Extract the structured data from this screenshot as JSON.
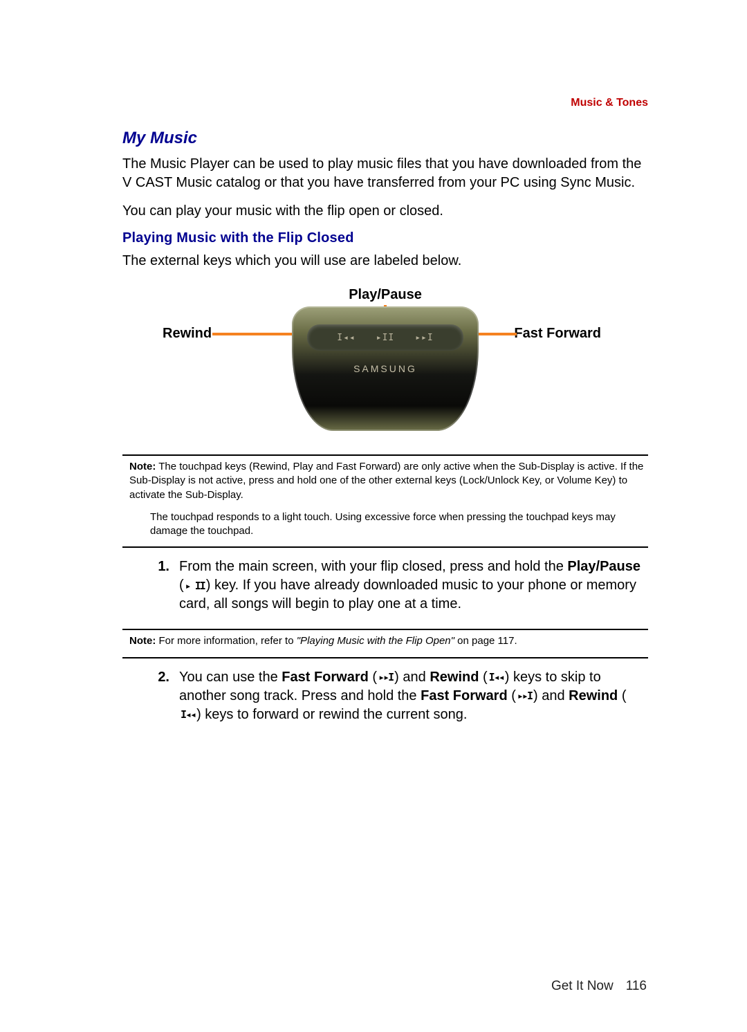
{
  "header": {
    "section": "Music & Tones"
  },
  "h1": "My Music",
  "p1": "The Music Player can be used to play music files that you have downloaded from the V CAST Music catalog or that you have transferred from your PC using Sync Music.",
  "p2": "You can play your music with the flip open or closed.",
  "h2": "Playing Music with the Flip Closed",
  "p3": "The external keys which you will use are labeled below.",
  "figure": {
    "playpause": "Play/Pause",
    "rewind": "Rewind",
    "fastforward": "Fast Forward",
    "brand": "SAMSUNG",
    "key_rewind_glyph": "I◂◂",
    "key_play_glyph": "▸II",
    "key_ff_glyph": "▸▸I"
  },
  "note1": {
    "lead": "Note:",
    "text": " The touchpad keys (Rewind, Play and Fast Forward) are only active when the Sub-Display is active. If the Sub-Display is not active, press and hold one of the other external keys (Lock/Unlock Key, or Volume Key) to activate the Sub-Display."
  },
  "note1b": "The touchpad responds to a light touch. Using excessive force when pressing the touchpad keys may damage the touchpad.",
  "step1": {
    "num": "1.",
    "pre": "From the main screen, with your flip closed, press and hold the ",
    "bold1": "Play/Pause",
    "paren1_open": " (",
    "icon1": "▸ II",
    "paren1_close": ") key. If you have already downloaded music to your phone or memory card, all songs will begin to play one at a time."
  },
  "note2": {
    "lead": "Note:",
    "text": " For more information, refer to ",
    "xref": "\"Playing Music with the Flip Open\"",
    "tail": "  on page 117."
  },
  "step2": {
    "num": "2.",
    "pre": "You can use the ",
    "b1": "Fast Forward",
    "po1": " (",
    "i1": "▸▸I",
    "pc1": ") and ",
    "b2": "Rewind",
    "po2": " (",
    "i2": "I◂◂",
    "pc2": ") keys to skip to another song track. Press and hold the ",
    "b3": "Fast Forward",
    "po3": " (",
    "i3": "▸▸I",
    "pc3": ") and ",
    "b4": "Rewind",
    "po4": " (",
    "i4": "I◂◂",
    "pc4": ") keys to forward or rewind the current song."
  },
  "footer": {
    "chapter": "Get It Now",
    "page": "116"
  }
}
